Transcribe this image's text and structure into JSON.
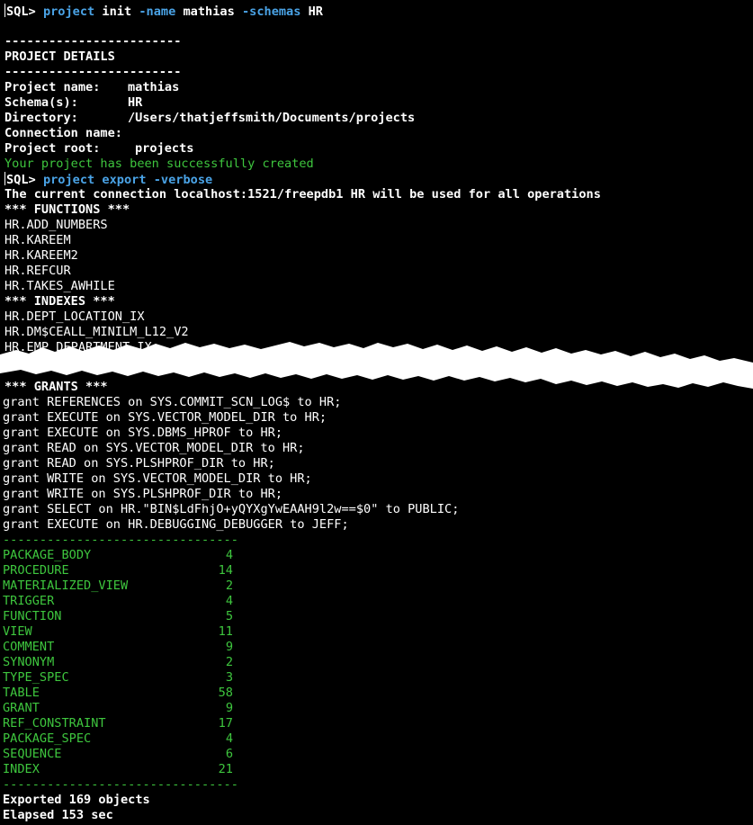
{
  "cmd1": {
    "prompt": "SQL>",
    "w1": "project",
    "w2": "init",
    "f1": "-name",
    "v1": "mathias",
    "f2": "-schemas",
    "v2": "HR"
  },
  "details": {
    "dash": "------------------------",
    "header": "PROJECT DETAILS",
    "rows": [
      {
        "k": "Project name:",
        "v": "mathias"
      },
      {
        "k": "Schema(s):",
        "v": "HR"
      },
      {
        "k": "Directory:",
        "v": "/Users/thatjeffsmith/Documents/projects"
      },
      {
        "k": "Connection name:",
        "v": ""
      },
      {
        "k": "Project root:",
        "v": "projects"
      }
    ],
    "success": "Your project has been successfully created"
  },
  "cmd2": {
    "prompt": "SQL>",
    "w1": "project",
    "w2": "export",
    "f1": "-verbose"
  },
  "connection_line": "The current connection localhost:1521/freepdb1 HR will be used for all operations",
  "functions_header": "*** FUNCTIONS ***",
  "functions": [
    "HR.ADD_NUMBERS",
    "HR.KAREEM",
    "HR.KAREEM2",
    "HR.REFCUR",
    "HR.TAKES_AWHILE"
  ],
  "indexes_header": "*** INDEXES ***",
  "indexes": [
    "HR.DEPT_LOCATION_IX",
    "HR.DM$CEALL_MINILM_L12_V2",
    "HR.EMP_DEPARTMENT_IX"
  ],
  "grants_header": "*** GRANTS ***",
  "grants": [
    "grant REFERENCES on SYS.COMMIT_SCN_LOG$ to HR;",
    "grant EXECUTE on SYS.VECTOR_MODEL_DIR to HR;",
    "grant EXECUTE on SYS.DBMS_HPROF to HR;",
    "grant READ on SYS.VECTOR_MODEL_DIR to HR;",
    "grant READ on SYS.PLSHPROF_DIR to HR;",
    "grant WRITE on SYS.VECTOR_MODEL_DIR to HR;",
    "grant WRITE on SYS.PLSHPROF_DIR to HR;",
    "grant SELECT on HR.\"BIN$LdFhjO+yQYXgYwEAAH9l2w==$0\" to PUBLIC;",
    "grant EXECUTE on HR.DEBUGGING_DEBUGGER to JEFF;"
  ],
  "summary_sep": "--------------------------------",
  "summary": [
    {
      "type": "PACKAGE_BODY",
      "count": "4"
    },
    {
      "type": "PROCEDURE",
      "count": "14"
    },
    {
      "type": "MATERIALIZED_VIEW",
      "count": "2"
    },
    {
      "type": "TRIGGER",
      "count": "4"
    },
    {
      "type": "FUNCTION",
      "count": "5"
    },
    {
      "type": "VIEW",
      "count": "11"
    },
    {
      "type": "COMMENT",
      "count": "9"
    },
    {
      "type": "SYNONYM",
      "count": "2"
    },
    {
      "type": "TYPE_SPEC",
      "count": "3"
    },
    {
      "type": "TABLE",
      "count": "58"
    },
    {
      "type": "GRANT",
      "count": "9"
    },
    {
      "type": "REF_CONSTRAINT",
      "count": "17"
    },
    {
      "type": "PACKAGE_SPEC",
      "count": "4"
    },
    {
      "type": "SEQUENCE",
      "count": "6"
    },
    {
      "type": "INDEX",
      "count": "21"
    }
  ],
  "exported": "Exported 169 objects",
  "elapsed": "Elapsed 153 sec"
}
